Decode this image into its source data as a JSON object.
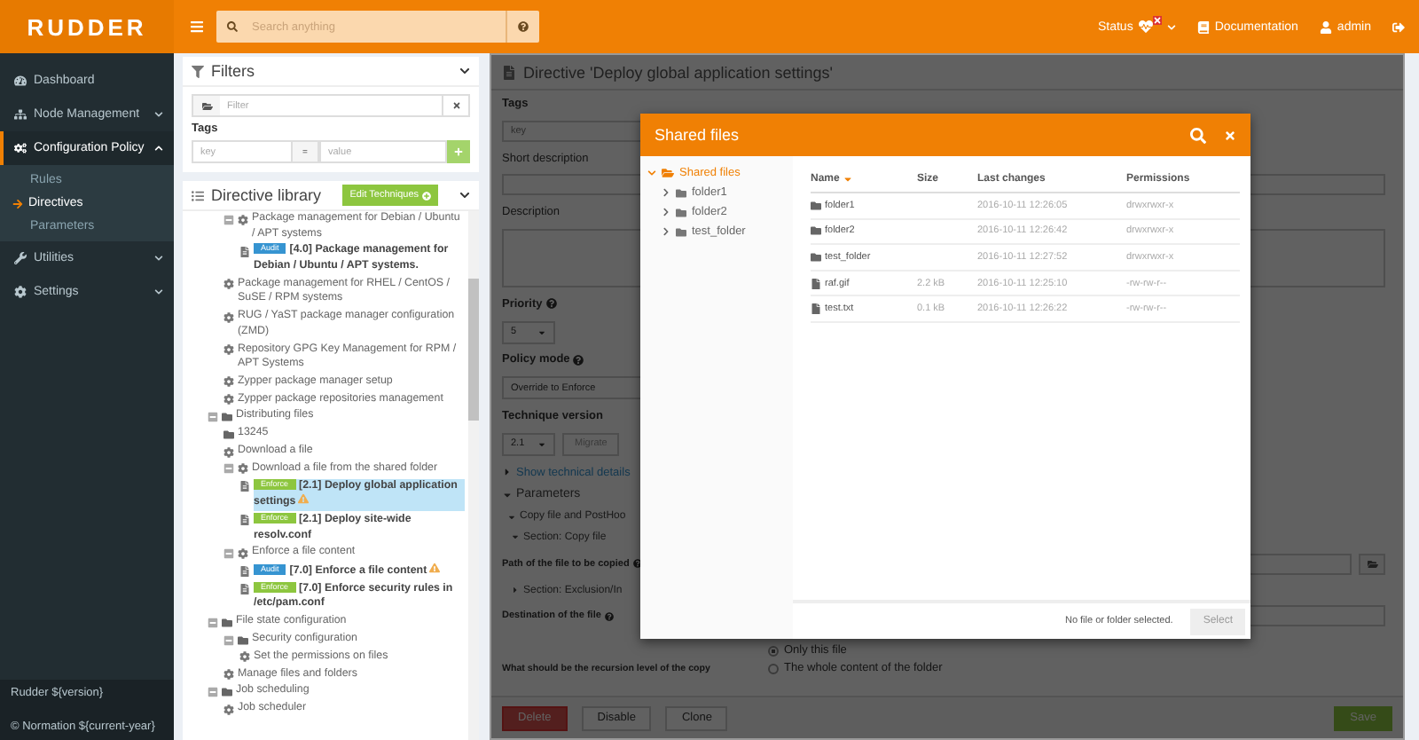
{
  "header": {
    "logo": "RUDDER",
    "search": {
      "placeholder": "Search anything"
    },
    "status": {
      "label": "Status",
      "alert": true
    },
    "links": [
      {
        "kind": "docs",
        "label": "Documentation"
      },
      {
        "kind": "user",
        "label": "admin"
      },
      {
        "kind": "logout"
      }
    ]
  },
  "sidebar": {
    "items": [
      {
        "label": "Dashboard",
        "expandable": false,
        "selected": false
      },
      {
        "label": "Node Management",
        "expandable": true,
        "expanded": false,
        "selected": false
      },
      {
        "label": "Configuration Policy",
        "expandable": true,
        "expanded": true,
        "selected": true,
        "children": [
          {
            "label": "Rules",
            "selected": false
          },
          {
            "label": "Directives",
            "selected": true
          },
          {
            "label": "Parameters",
            "selected": false
          }
        ]
      },
      {
        "label": "Utilities",
        "expandable": true,
        "expanded": false,
        "selected": false
      },
      {
        "label": "Settings",
        "expandable": true,
        "expanded": false,
        "selected": false
      }
    ],
    "footer": [
      "Rudder ${version}",
      "© Normation ${current-year}"
    ]
  },
  "filters": {
    "title": "Filters",
    "filter": {
      "placeholder": "Filter"
    },
    "tags_label": "Tags",
    "key": {
      "placeholder": "key"
    },
    "tag_separator": "=",
    "value": {
      "placeholder": "value"
    }
  },
  "library": {
    "title": "Directive library",
    "edit_button": "Edit Techniques",
    "continued_items": [
      {
        "kind": "technique",
        "label": "Package management for Debian / Ubuntu / APT systems",
        "expanded": true,
        "children": [
          {
            "kind": "directive",
            "mode": "Audit",
            "label": "[4.0] Package management for Debian / Ubuntu / APT systems.",
            "warning": false,
            "selected": false
          }
        ]
      },
      {
        "kind": "technique",
        "label": "Package management for RHEL / CentOS / SuSE / RPM systems"
      },
      {
        "kind": "technique",
        "label": "RUG / YaST package manager configuration (ZMD)"
      },
      {
        "kind": "technique",
        "label": "Repository GPG Key Management for RPM / APT Systems"
      },
      {
        "kind": "technique",
        "label": "Zypper package manager setup"
      },
      {
        "kind": "technique",
        "label": "Zypper package repositories management"
      }
    ],
    "tree": [
      {
        "kind": "category",
        "label": "Distributing files",
        "expanded": true,
        "children": [
          {
            "kind": "category",
            "label": "13245"
          },
          {
            "kind": "technique",
            "label": "Download a file"
          },
          {
            "kind": "technique",
            "label": "Download a file from the shared folder",
            "expanded": true,
            "children": [
              {
                "kind": "directive",
                "mode": "Enforce",
                "label": "[2.1] Deploy global application settings",
                "warning": true,
                "selected": true
              },
              {
                "kind": "directive",
                "mode": "Enforce",
                "label": "[2.1] Deploy site-wide resolv.conf",
                "warning": false,
                "selected": false
              }
            ]
          },
          {
            "kind": "technique",
            "label": "Enforce a file content",
            "expanded": true,
            "children": [
              {
                "kind": "directive",
                "mode": "Audit",
                "label": "[7.0] Enforce a file content",
                "warning": true,
                "selected": false
              },
              {
                "kind": "directive",
                "mode": "Enforce",
                "label": "[7.0] Enforce security rules in /etc/pam.conf",
                "warning": false,
                "selected": false
              }
            ]
          }
        ]
      },
      {
        "kind": "category",
        "label": "File state configuration",
        "expanded": true,
        "children": [
          {
            "kind": "category",
            "label": "Security configuration",
            "expanded": true,
            "children": [
              {
                "kind": "technique",
                "label": "Set the permissions on files"
              }
            ]
          },
          {
            "kind": "technique",
            "label": "Manage files and folders"
          }
        ]
      },
      {
        "kind": "category",
        "label": "Job scheduling",
        "expanded": true,
        "children": [
          {
            "kind": "technique",
            "label": "Job scheduler"
          }
        ]
      }
    ]
  },
  "directive": {
    "title": "Directive 'Deploy global application settings'",
    "tags_label": "Tags",
    "tag_key": {
      "placeholder": "key"
    },
    "short_label": "Short description",
    "desc_label": "Description",
    "priority_label": "Priority",
    "priority": "5",
    "mode_label": "Policy mode",
    "mode": "Override to Enforce",
    "version_label": "Technique version",
    "version": "2.1",
    "migrate": "Migrate",
    "details_link": "Show technical details",
    "parameters": "Parameters",
    "section_top": "Copy file and PostHoo",
    "section_copy": "Section: Copy file",
    "path_label": "Path of the file to be copied",
    "section_excl": "Section: Exclusion/In",
    "dest_label": "Destination of the file",
    "recursion_label": "What should be the recursion level of the copy",
    "recursion_options": [
      {
        "label": "Only this file",
        "selected": true
      },
      {
        "label": "The whole content of the folder",
        "selected": false
      }
    ],
    "buttons": [
      {
        "kind": "danger",
        "label": "Delete"
      },
      {
        "kind": "default",
        "label": "Disable"
      },
      {
        "kind": "default",
        "label": "Clone"
      },
      {
        "kind": "success",
        "label": "Save"
      }
    ]
  },
  "modal": {
    "title": "Shared files",
    "root": {
      "label": "Shared files",
      "expanded": true,
      "children": [
        "folder1",
        "folder2",
        "test_folder"
      ]
    },
    "columns": [
      {
        "label": "Name",
        "sorted": true
      },
      {
        "label": "Size",
        "sorted": false
      },
      {
        "label": "Last changes",
        "sorted": false
      },
      {
        "label": "Permissions",
        "sorted": false
      }
    ],
    "rows": [
      {
        "kind": "folder",
        "name": "folder1",
        "date": "2016-10-11 12:26:05",
        "perm": "drwxrwxr-x"
      },
      {
        "kind": "folder",
        "name": "folder2",
        "date": "2016-10-11 12:26:42",
        "perm": "drwxrwxr-x"
      },
      {
        "kind": "folder",
        "name": "test_folder",
        "date": "2016-10-11 12:27:52",
        "perm": "drwxrwxr-x"
      },
      {
        "kind": "file",
        "name": "raf.gif",
        "size": "2.2 kB",
        "date": "2016-10-11 12:25:10",
        "perm": "-rw-rw-r--"
      },
      {
        "kind": "file",
        "name": "test.txt",
        "size": "0.1 kB",
        "date": "2016-10-11 12:26:22",
        "perm": "-rw-rw-r--"
      }
    ],
    "footer_text": "No file or folder selected.",
    "select_button": {
      "label": "Select",
      "disabled": true
    }
  }
}
